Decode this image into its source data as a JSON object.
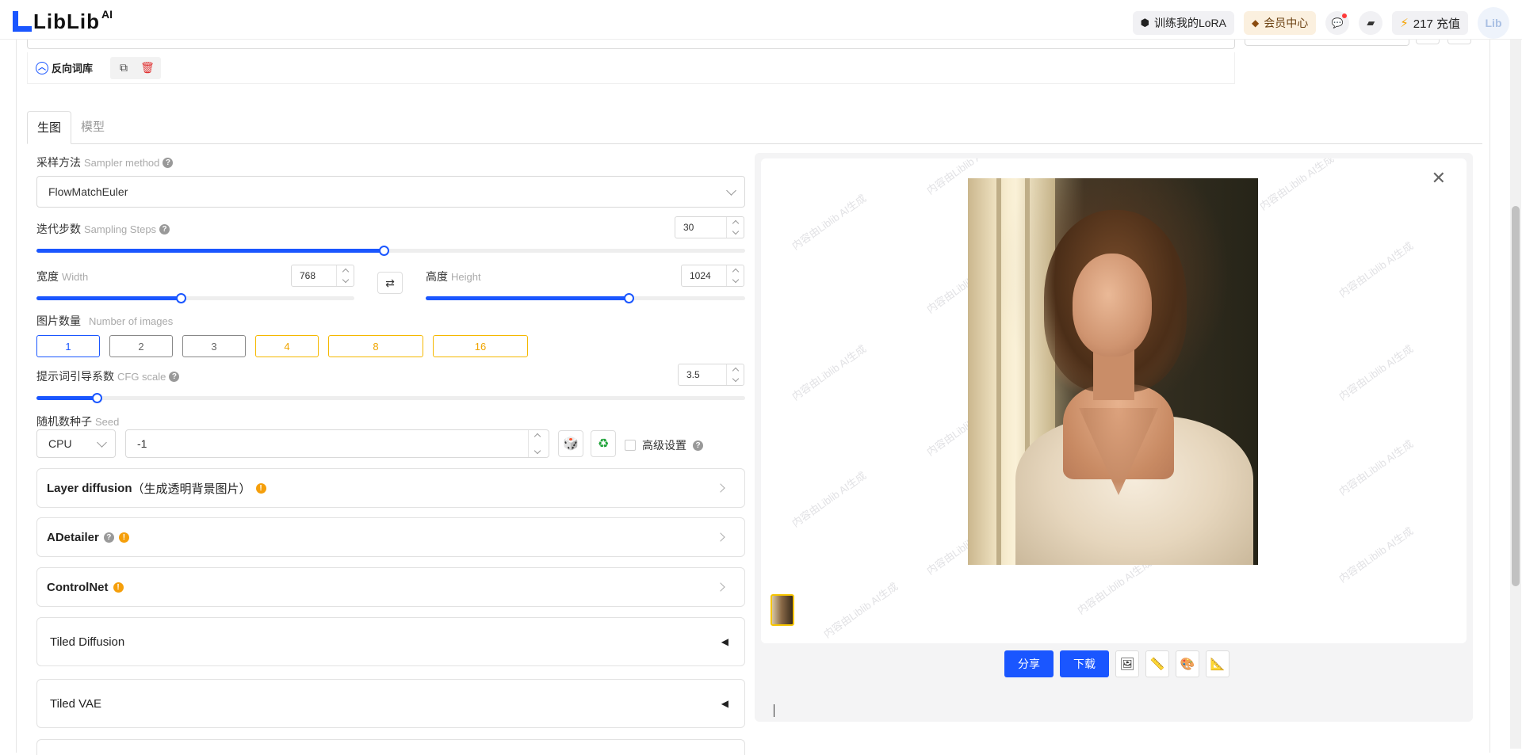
{
  "topbar": {
    "logo_text": "LibLib",
    "logo_sup": "AI",
    "train_lora": "训练我的LoRA",
    "vip_center": "会员中心",
    "power_count": "217 充值",
    "avatar_text": "Lib"
  },
  "negative": {
    "label": "反向词库"
  },
  "tabs": [
    {
      "label": "生图",
      "active": true
    },
    {
      "label": "模型",
      "active": false
    }
  ],
  "form": {
    "sampler": {
      "label": "采样方法",
      "en": "Sampler method",
      "value": "FlowMatchEuler"
    },
    "steps": {
      "label": "迭代步数",
      "en": "Sampling Steps",
      "value": "30",
      "fill": 0.49
    },
    "width": {
      "label": "宽度",
      "en": "Width",
      "value": "768",
      "fill": 0.455
    },
    "height": {
      "label": "高度",
      "en": "Height",
      "value": "1024",
      "fill": 0.635
    },
    "num_images": {
      "label": "图片数量",
      "en": "Number of images",
      "options": [
        "1",
        "2",
        "3",
        "4",
        "8",
        "16"
      ],
      "selected": "1"
    },
    "cfg": {
      "label": "提示词引导系数",
      "en": "CFG scale",
      "value": "3.5",
      "fill": 0.085
    },
    "seed": {
      "label": "随机数种子",
      "en": "Seed",
      "device": "CPU",
      "value": "-1"
    },
    "advanced": "高级设置"
  },
  "accordions": [
    {
      "title": "Layer diffusion",
      "suffix": "（生成透明背景图片）"
    },
    {
      "title": "ADetailer"
    },
    {
      "title": "ControlNet"
    },
    {
      "title": "Tiled Diffusion"
    },
    {
      "title": "Tiled VAE"
    }
  ],
  "preview": {
    "watermark": "内容由Liblib AI生成",
    "share": "分享",
    "download": "下载"
  },
  "icons": {
    "copy": "copy-icon",
    "delete": "trash-icon",
    "swap": "swap-icon",
    "dice": "dice-icon",
    "recycle": "recycle-icon",
    "close": "close-icon"
  },
  "colors": {
    "accent": "#1a56ff",
    "gold": "#f5b800",
    "warn": "#f59f0b"
  }
}
